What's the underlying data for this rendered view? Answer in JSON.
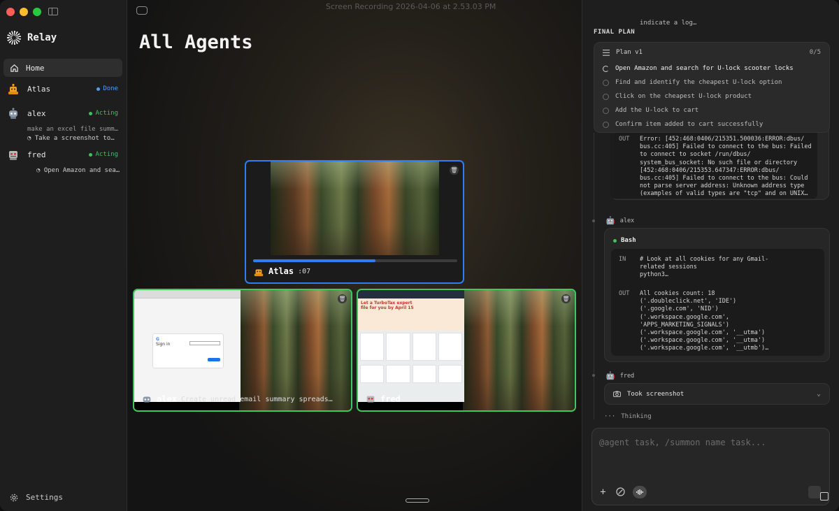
{
  "window": {
    "title": "Screen Recording 2026-04-06 at 2.53.03 PM"
  },
  "sidebar": {
    "brand": "Relay",
    "home_label": "Home",
    "settings_label": "Settings",
    "agents": [
      {
        "name": "Atlas",
        "status": "Done",
        "avatar_icon": "orange-robot-icon"
      },
      {
        "name": "alex",
        "status": "Acting",
        "sub_task": "make an excel file summ…",
        "sub_action": "Take a screenshot to…",
        "avatar_icon": "gray-robot-icon"
      },
      {
        "name": "fred",
        "status": "Acting",
        "sub_action": "Open Amazon and searc…",
        "avatar_icon": "red-robot-icon"
      }
    ]
  },
  "main": {
    "page_title": "All Agents",
    "cards": {
      "atlas": {
        "name": "Atlas",
        "time": ":07",
        "progress": 0.6
      },
      "alex": {
        "name": "alex",
        "task": "Create unread email summary spreads…"
      },
      "fred": {
        "name": "fred"
      }
    },
    "thumbnail_text": {
      "sign_in": "Sign in",
      "turbotax_banner": "Let a TurboTax expert file for you by April 15"
    }
  },
  "panel": {
    "faded_text": "indicate a log…",
    "final_plan_label": "FINAL PLAN",
    "plan": {
      "title": "Plan v1",
      "count": "0/5",
      "steps": [
        "Open Amazon and search for U-lock scooter locks",
        "Find and identify the cheapest U-lock option",
        "Click on the cheapest U-lock product",
        "Add the U-lock to cart",
        "Confirm item added to cart successfully"
      ]
    },
    "error_block": {
      "label": "OUT",
      "text": "Error: [452:468:0406/215351.500036:ERROR:dbus/\nbus.cc:405] Failed to connect to the bus: Failed\nto connect to socket /run/dbus/\nsystem_bus_socket: No such file or directory\n[452:468:0406/215353.647347:ERROR:dbus/\nbus.cc:405] Failed to connect to the bus: Could\nnot parse server address: Unknown address type\n(examples of valid types are \"tcp\" and on UNIX…"
    },
    "alex_label": "alex",
    "bash": {
      "title": "Bash",
      "in_label": "IN",
      "in_text": "# Look at all cookies for any Gmail-\nrelated sessions\npython3…",
      "out_label": "OUT",
      "out_text": "All cookies count: 18\n('.doubleclick.net', 'IDE')\n('.google.com', 'NID')\n('.workspace.google.com',\n'APPS_MARKETING_SIGNALS')\n('.workspace.google.com', '__utma')\n('.workspace.google.com', '__utma')\n('.workspace.google.com', '__utmb')…"
    },
    "fred_label": "fred",
    "screenshot_label": "Took screenshot",
    "thinking_label": "Thinking",
    "composer_placeholder": "@agent task, /summon name task..."
  },
  "colors": {
    "accent_blue": "#2f7df6",
    "acting_green": "#3ec25a",
    "done_blue": "#4a9eff"
  }
}
